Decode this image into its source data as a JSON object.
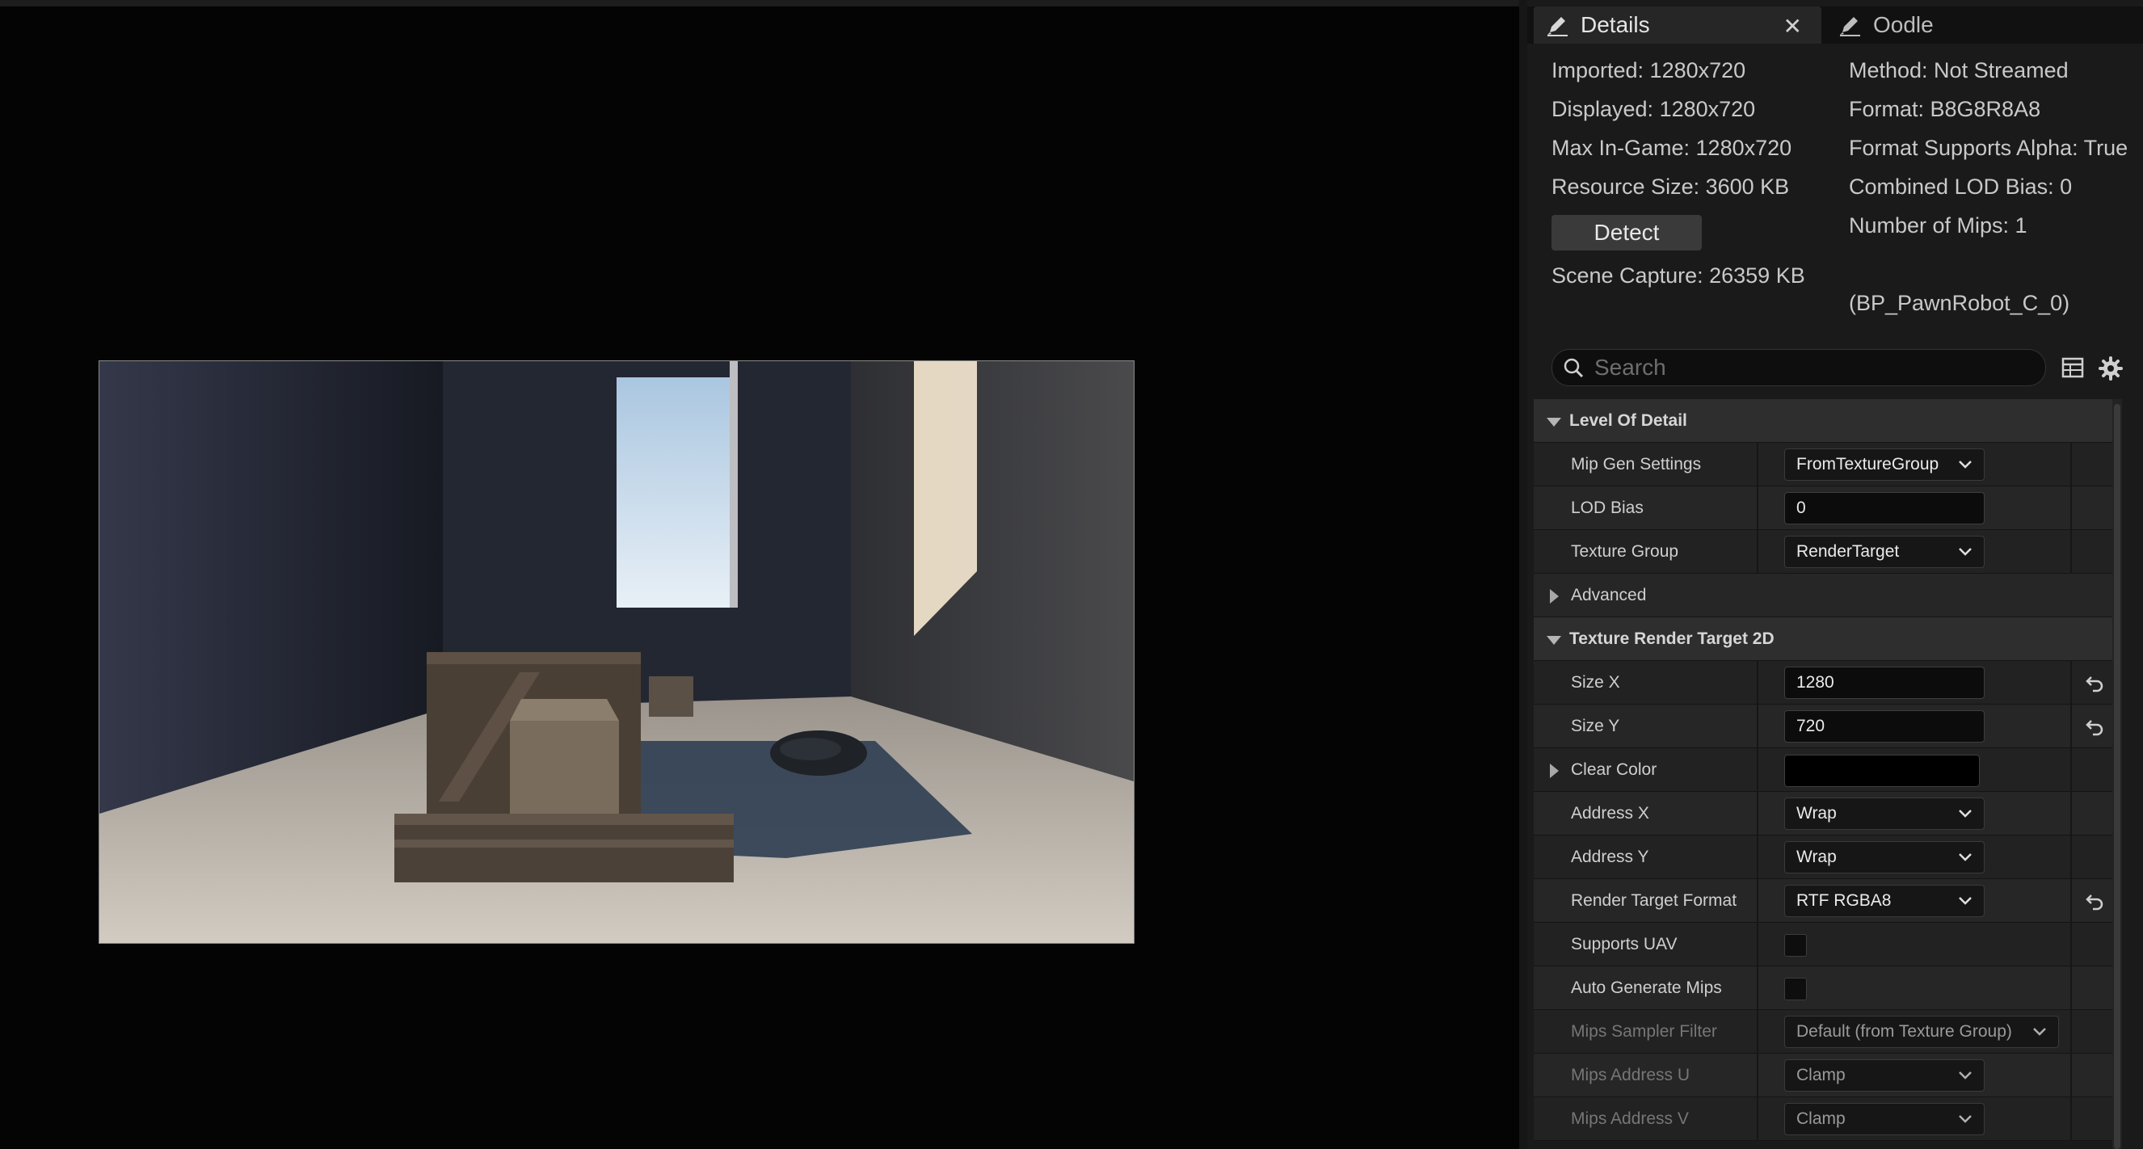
{
  "viewport": {
    "scene_alt": "render target preview"
  },
  "tabs": [
    {
      "label": "Details",
      "icon": "pencil-icon",
      "active": true
    },
    {
      "label": "Oodle",
      "icon": "pencil-icon",
      "active": false
    }
  ],
  "info": {
    "imported": "Imported: 1280x720",
    "displayed": "Displayed: 1280x720",
    "max_in_game": "Max In-Game: 1280x720",
    "resource_size": "Resource Size: 3600 KB",
    "detect_button": "Detect",
    "scene_capture": "Scene Capture: 26359 KB",
    "method": "Method: Not Streamed",
    "format": "Format: B8G8R8A8",
    "format_supports_alpha": "Format Supports Alpha: True",
    "combined_lod_bias": "Combined LOD Bias: 0",
    "number_of_mips": "Number of Mips: 1",
    "owner": "(BP_PawnRobot_C_0)"
  },
  "search": {
    "placeholder": "Search",
    "value": ""
  },
  "sections": {
    "level_of_detail": {
      "title": "Level Of Detail",
      "mip_gen_settings": {
        "label": "Mip Gen Settings",
        "value": "FromTextureGroup"
      },
      "lod_bias": {
        "label": "LOD Bias",
        "value": "0"
      },
      "texture_group": {
        "label": "Texture Group",
        "value": "RenderTarget"
      },
      "advanced": {
        "label": "Advanced"
      }
    },
    "texture_render_target_2d": {
      "title": "Texture Render Target 2D",
      "size_x": {
        "label": "Size X",
        "value": "1280"
      },
      "size_y": {
        "label": "Size Y",
        "value": "720"
      },
      "clear_color": {
        "label": "Clear Color",
        "color": "#000000"
      },
      "address_x": {
        "label": "Address X",
        "value": "Wrap"
      },
      "address_y": {
        "label": "Address Y",
        "value": "Wrap"
      },
      "render_target_format": {
        "label": "Render Target Format",
        "value": "RTF RGBA8"
      },
      "supports_uav": {
        "label": "Supports UAV",
        "checked": false
      },
      "auto_generate_mips": {
        "label": "Auto Generate Mips",
        "checked": false
      },
      "mips_sampler_filter": {
        "label": "Mips Sampler Filter",
        "value": "Default (from Texture Group)"
      },
      "mips_address_u": {
        "label": "Mips Address U",
        "value": "Clamp"
      },
      "mips_address_v": {
        "label": "Mips Address V",
        "value": "Clamp"
      }
    }
  },
  "colors": {
    "panel_bg": "#1a1a1a",
    "category_bg": "#2e2e2e",
    "text": "#cfcfcf",
    "disabled_text": "#767676"
  }
}
